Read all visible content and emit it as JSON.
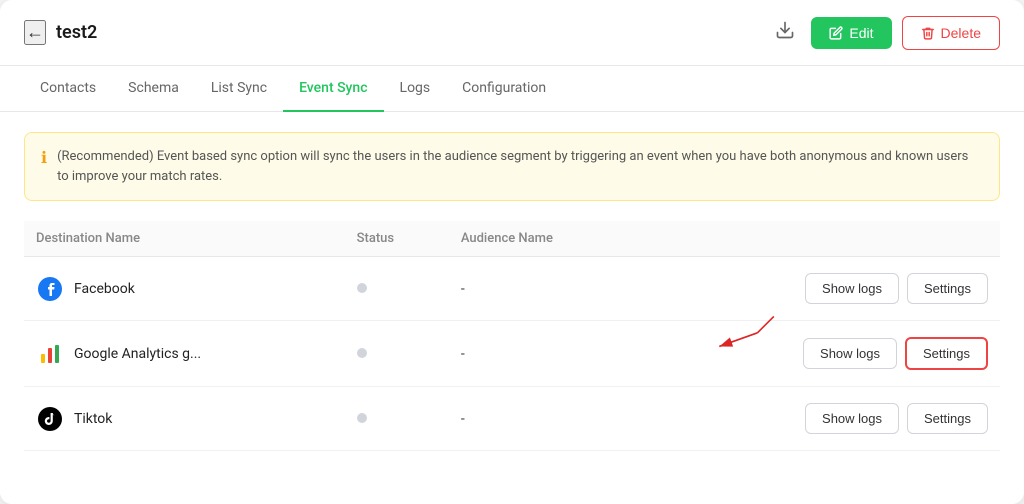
{
  "header": {
    "back_label": "←",
    "title": "test2",
    "download_icon": "⬇",
    "edit_label": "Edit",
    "edit_icon": "✎",
    "delete_label": "Delete",
    "delete_icon": "🗑"
  },
  "tabs": [
    {
      "id": "contacts",
      "label": "Contacts",
      "active": false
    },
    {
      "id": "schema",
      "label": "Schema",
      "active": false
    },
    {
      "id": "list-sync",
      "label": "List Sync",
      "active": false
    },
    {
      "id": "event-sync",
      "label": "Event Sync",
      "active": true
    },
    {
      "id": "logs",
      "label": "Logs",
      "active": false
    },
    {
      "id": "configuration",
      "label": "Configuration",
      "active": false
    }
  ],
  "banner": {
    "text": "(Recommended) Event based sync option will sync the users in the audience segment by triggering an event when you have both anonymous and known users to improve your match rates."
  },
  "table": {
    "columns": [
      {
        "id": "destination",
        "label": "Destination Name"
      },
      {
        "id": "status",
        "label": "Status"
      },
      {
        "id": "audience",
        "label": "Audience Name"
      },
      {
        "id": "actions",
        "label": ""
      }
    ],
    "rows": [
      {
        "id": "facebook",
        "destination": "Facebook",
        "icon": "facebook",
        "status": "inactive",
        "audience": "-",
        "show_logs_label": "Show logs",
        "settings_label": "Settings",
        "highlighted": false
      },
      {
        "id": "google-analytics",
        "destination": "Google Analytics g...",
        "icon": "google-analytics",
        "status": "inactive",
        "audience": "-",
        "show_logs_label": "Show logs",
        "settings_label": "Settings",
        "highlighted": true
      },
      {
        "id": "tiktok",
        "destination": "Tiktok",
        "icon": "tiktok",
        "status": "inactive",
        "audience": "-",
        "show_logs_label": "Show logs",
        "settings_label": "Settings",
        "highlighted": false
      }
    ]
  }
}
